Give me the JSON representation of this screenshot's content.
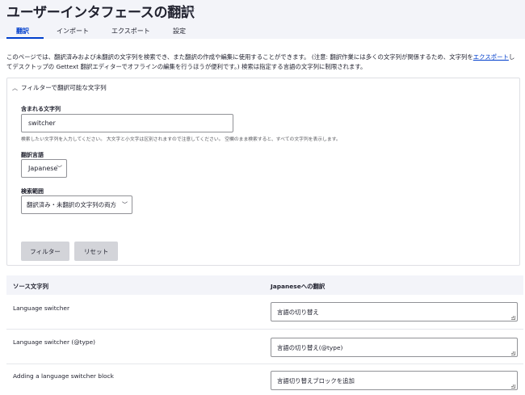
{
  "page": {
    "title": "ユーザーインタフェースの翻訳",
    "favorite_icon": "star-outline-icon"
  },
  "tabs": [
    {
      "label": "翻訳",
      "active": true
    },
    {
      "label": "インポート",
      "active": false
    },
    {
      "label": "エクスポート",
      "active": false
    },
    {
      "label": "設定",
      "active": false
    }
  ],
  "description": {
    "part1": "このページでは、翻訳済みおよび未翻訳の文字列を検索でき、また翻訳の作成や編集に使用することができます。 (注意: 翻訳作業には多くの文字列が関係するため、文字列を",
    "link1": "エクスポート",
    "part2": "してデスクトップの Gettext 翻訳エディターでオフラインの編集を行うほうが便利です。) 検索は指定する言語の文字列に制限されます。"
  },
  "filter": {
    "heading": "フィルターで翻訳可能な文字列",
    "contains_label": "含まれる文字列",
    "contains_value": "switcher",
    "contains_help": "検索したい文字列を入力してください。 大文字と小文字は区別されますので注意してください。 空欄のまま検索すると、すべての文字列を表示します。",
    "language_label": "翻訳言語",
    "language_value": "Japanese",
    "scope_label": "検索範囲",
    "scope_value": "翻訳済み・未翻訳の文字列の両方",
    "filter_button": "フィルター",
    "reset_button": "リセット"
  },
  "table": {
    "col_source": "ソース文字列",
    "col_translation": "Japaneseへの翻訳",
    "rows": [
      {
        "source": "Language switcher",
        "translation": "言語の切り替え"
      },
      {
        "source": "Language switcher (@type)",
        "translation": "言語の切り替え(@type)"
      },
      {
        "source": "Adding a language switcher block",
        "translation": "言語切り替えブロックを追加"
      }
    ]
  }
}
